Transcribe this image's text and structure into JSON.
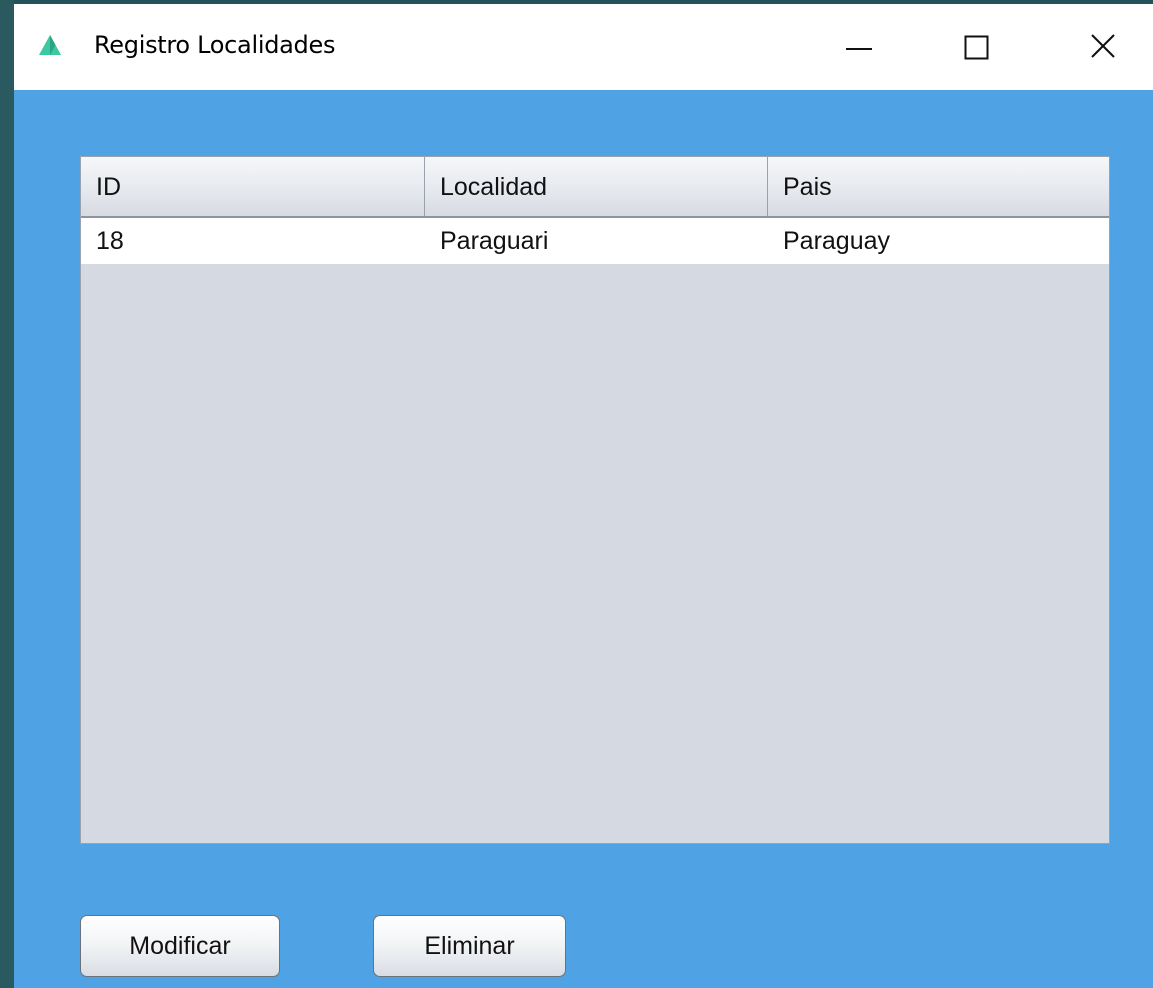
{
  "window": {
    "title": "Registro Localidades",
    "icons": {
      "app": "triangle-app-icon",
      "minimize": "minimize-icon",
      "maximize": "maximize-icon",
      "close": "close-icon"
    }
  },
  "table": {
    "columns": [
      "ID",
      "Localidad",
      "Pais"
    ],
    "rows": [
      [
        "18",
        "Paraguari",
        "Paraguay"
      ]
    ]
  },
  "buttons": {
    "modificar": "Modificar",
    "eliminar": "Eliminar"
  },
  "colors": {
    "background": "#4fa2e4",
    "table_empty": "#d5d9e1",
    "app_icon": "#3cc8a0"
  }
}
